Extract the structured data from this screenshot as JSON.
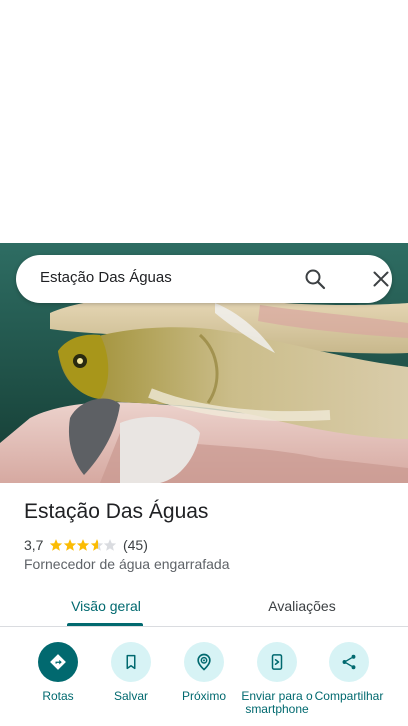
{
  "search": {
    "query": "Estação Das Águas",
    "search_icon": "search-icon",
    "close_icon": "close-icon"
  },
  "place": {
    "name": "Estação Das Águas",
    "rating": "3,7",
    "rating_value": 3.7,
    "review_count": "(45)",
    "category": "Fornecedor de água engarrafada"
  },
  "tabs": [
    {
      "label": "Visão geral",
      "selected": true
    },
    {
      "label": "Avaliações",
      "selected": false
    }
  ],
  "actions": [
    {
      "label": "Rotas",
      "icon": "directions-icon"
    },
    {
      "label": "Salvar",
      "icon": "bookmark-icon"
    },
    {
      "label": "Próximo",
      "icon": "nearby-icon"
    },
    {
      "label": "Enviar para o smartphone",
      "icon": "send-to-phone-icon"
    },
    {
      "label": "Compartilhar",
      "icon": "share-icon"
    }
  ],
  "colors": {
    "accent": "#01696f",
    "action_bg": "#d7f3f5",
    "star": "#fbbc04",
    "star_empty": "#dadce0"
  }
}
